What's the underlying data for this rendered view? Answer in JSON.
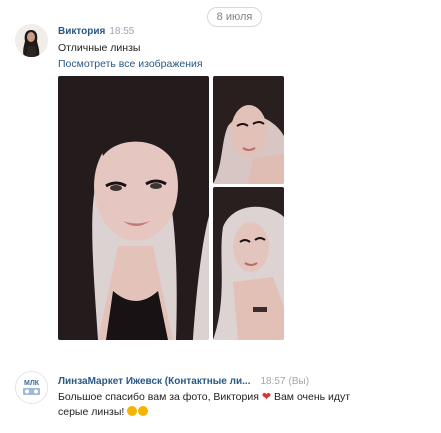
{
  "date_separator": "8 июля",
  "messages": [
    {
      "author": "Виктория",
      "time": "18:55",
      "text": "Отличные линзы",
      "link": "Посмотреть все изображения"
    },
    {
      "author": "ЛинзаМаркет Ижевск (Контактные ли...",
      "time": "18:57",
      "time_suffix": "(Вы)",
      "text_line1": "Большое спасибо вам за фото, Виктория",
      "text_line1_tail": "Вам очень идут",
      "text_line2": "серые линзы!"
    }
  ],
  "logo_text": "МЛК",
  "icons": {
    "heart": "heart-icon",
    "emoji": "smiling-heart-eyes-emoji"
  }
}
